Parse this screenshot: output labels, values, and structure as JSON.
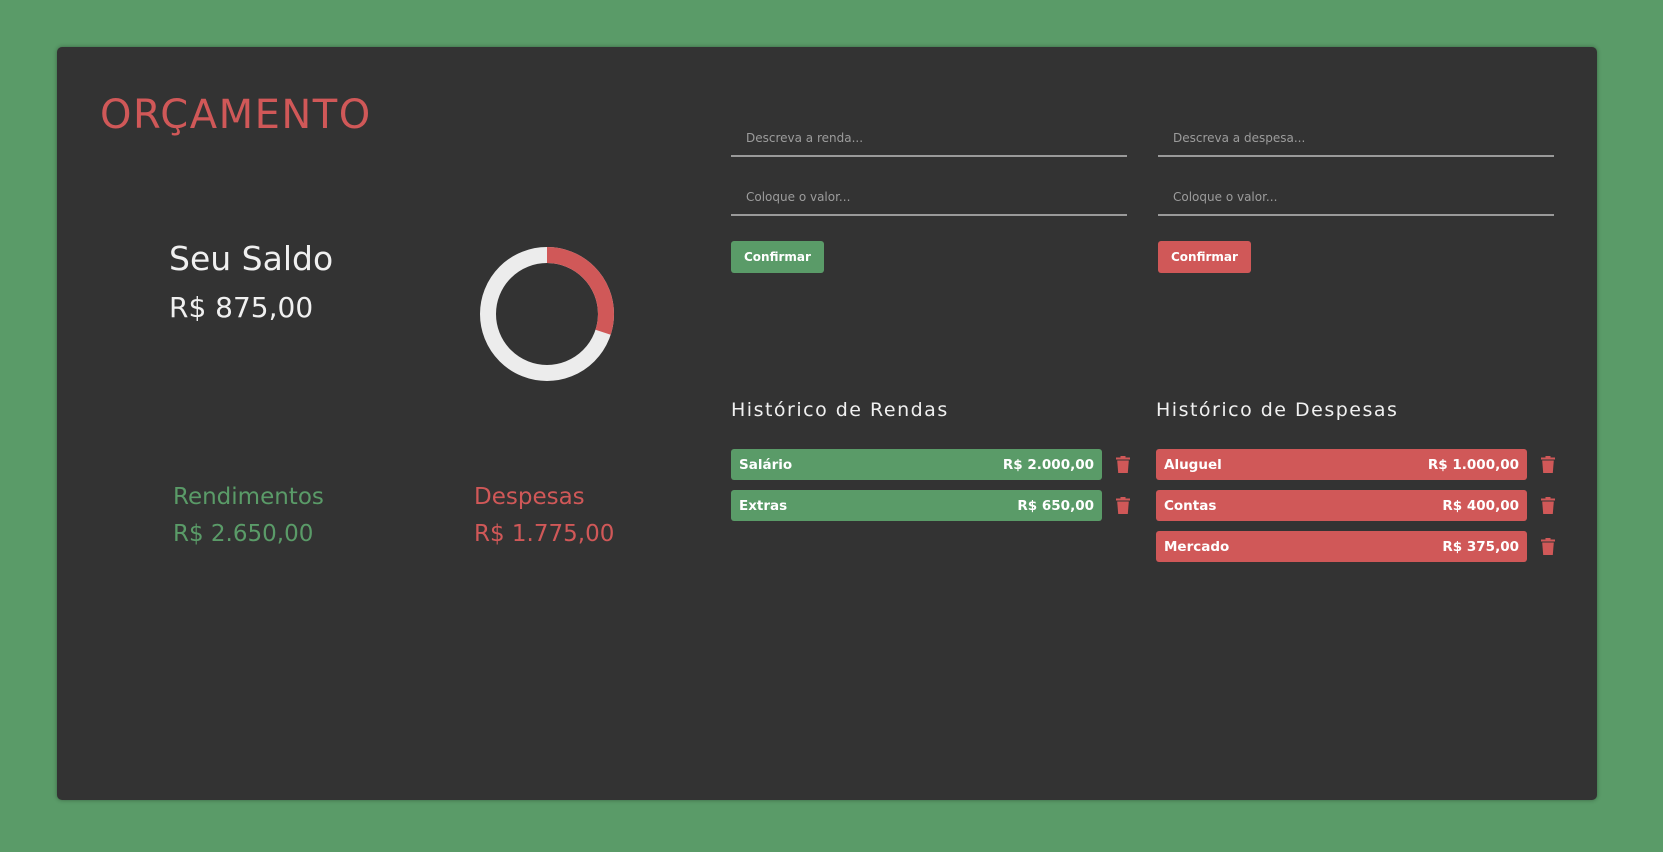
{
  "app": {
    "title": "ORÇAMENTO"
  },
  "summary": {
    "balance_label": "Seu Saldo",
    "balance_value": "R$ 875,00",
    "income_label": "Rendimentos",
    "income_value": "R$ 2.650,00",
    "expense_label": "Despesas",
    "expense_value": "R$ 1.775,00",
    "chart_expense_fraction": 0.3
  },
  "income_form": {
    "description_placeholder": "Descreva a renda...",
    "value_placeholder": "Coloque o valor...",
    "confirm_label": "Confirmar"
  },
  "expense_form": {
    "description_placeholder": "Descreva a despesa...",
    "value_placeholder": "Coloque o valor...",
    "confirm_label": "Confirmar"
  },
  "income_history": {
    "title": "Histórico de Rendas",
    "items": [
      {
        "name": "Salário",
        "amount": "R$ 2.000,00"
      },
      {
        "name": "Extras",
        "amount": "R$ 650,00"
      }
    ]
  },
  "expense_history": {
    "title": "Histórico de Despesas",
    "items": [
      {
        "name": "Aluguel",
        "amount": "R$ 1.000,00"
      },
      {
        "name": "Contas",
        "amount": "R$ 400,00"
      },
      {
        "name": "Mercado",
        "amount": "R$ 375,00"
      }
    ]
  },
  "colors": {
    "background": "#5a9b68",
    "card": "#333333",
    "income": "#5a9b68",
    "expense": "#d05858",
    "ring_base": "#ececec"
  },
  "icons": {
    "delete": "trash-icon"
  }
}
